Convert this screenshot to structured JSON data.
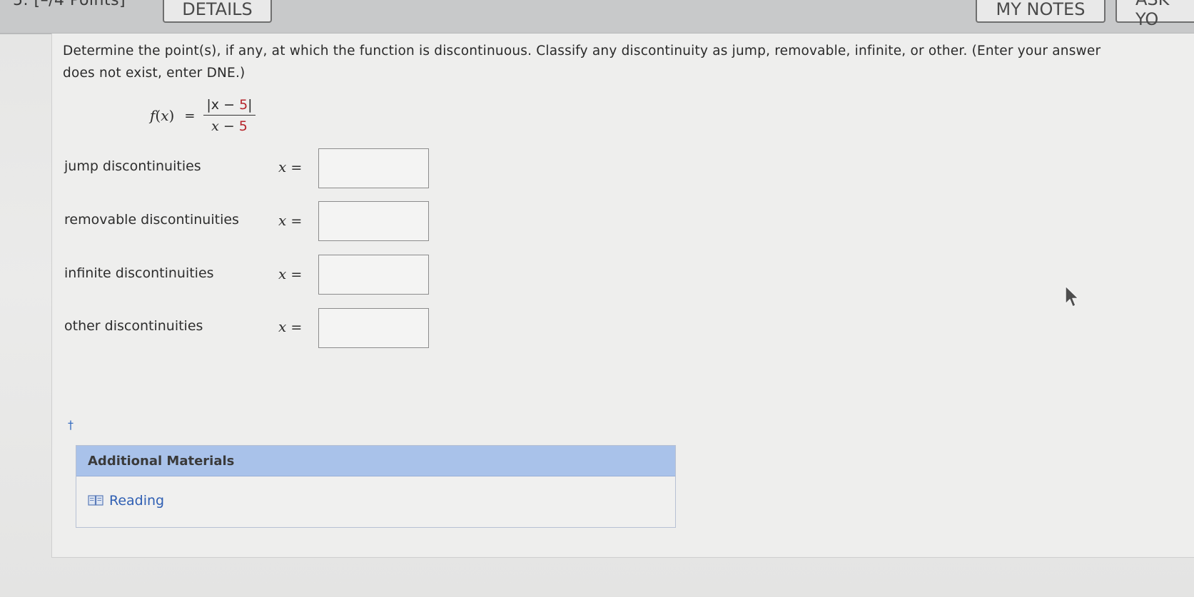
{
  "header": {
    "points_label": "5.  [–/4 Points]",
    "details_button": "DETAILS",
    "my_notes_button": "MY NOTES",
    "ask_button": "ASK YO"
  },
  "question": {
    "prompt_line1": "Determine the point(s), if any, at which the function is discontinuous. Classify any discontinuity as jump, removable, infinite, or other. (Enter your answer",
    "prompt_line2": "does not exist, enter DNE.)",
    "function": {
      "name": "f",
      "var": "x",
      "equals": "=",
      "numerator_pre": "|x − ",
      "numerator_num": "5",
      "numerator_post": "|",
      "denominator_pre": "x − ",
      "denominator_num": "5"
    },
    "rows": [
      {
        "label": "jump discontinuities",
        "var": "x",
        "equals": "=",
        "value": ""
      },
      {
        "label": "removable discontinuities",
        "var": "x",
        "equals": "=",
        "value": ""
      },
      {
        "label": "infinite discontinuities",
        "var": "x",
        "equals": "=",
        "value": ""
      },
      {
        "label": "other discontinuities",
        "var": "x",
        "equals": "=",
        "value": ""
      }
    ],
    "dagger": "†"
  },
  "materials": {
    "header": "Additional Materials",
    "link_label": "Reading"
  },
  "colors": {
    "red_number": "#b6242a",
    "link_blue": "#2f5fb3",
    "materials_header_bg": "#a9c2ea"
  },
  "icons": {
    "reading": "book-icon",
    "pointer": "mouse-cursor-icon"
  }
}
